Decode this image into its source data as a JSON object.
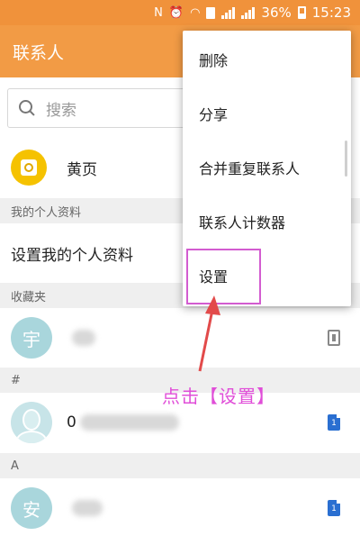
{
  "status_bar": {
    "battery": "36%",
    "time": "15:23"
  },
  "app_bar": {
    "title": "联系人"
  },
  "search": {
    "placeholder": "搜索"
  },
  "yellow_pages": {
    "label": "黄页"
  },
  "sections": {
    "my_profile": "我的个人资料",
    "favorites": "收藏夹",
    "hash": "#",
    "a": "A"
  },
  "profile": {
    "setup_label": "设置我的个人资料"
  },
  "contacts": [
    {
      "avatar_char": "宇",
      "name": "",
      "storage": "phone"
    },
    {
      "avatar_char": "",
      "name": "0",
      "storage": "sim"
    },
    {
      "avatar_char": "安",
      "name": "",
      "storage": "sim"
    }
  ],
  "menu": {
    "items": [
      "删除",
      "分享",
      "合并重复联系人",
      "联系人计数器",
      "设置"
    ]
  },
  "annotation": {
    "text": "点击【设置】",
    "color": "#e04ed8"
  },
  "colors": {
    "app_bar": "#f29b45",
    "status_bar": "#f0923b",
    "avatar": "#a9d6dc",
    "yellow_pages": "#f5c200",
    "sim_badge": "#2a6fd1"
  }
}
